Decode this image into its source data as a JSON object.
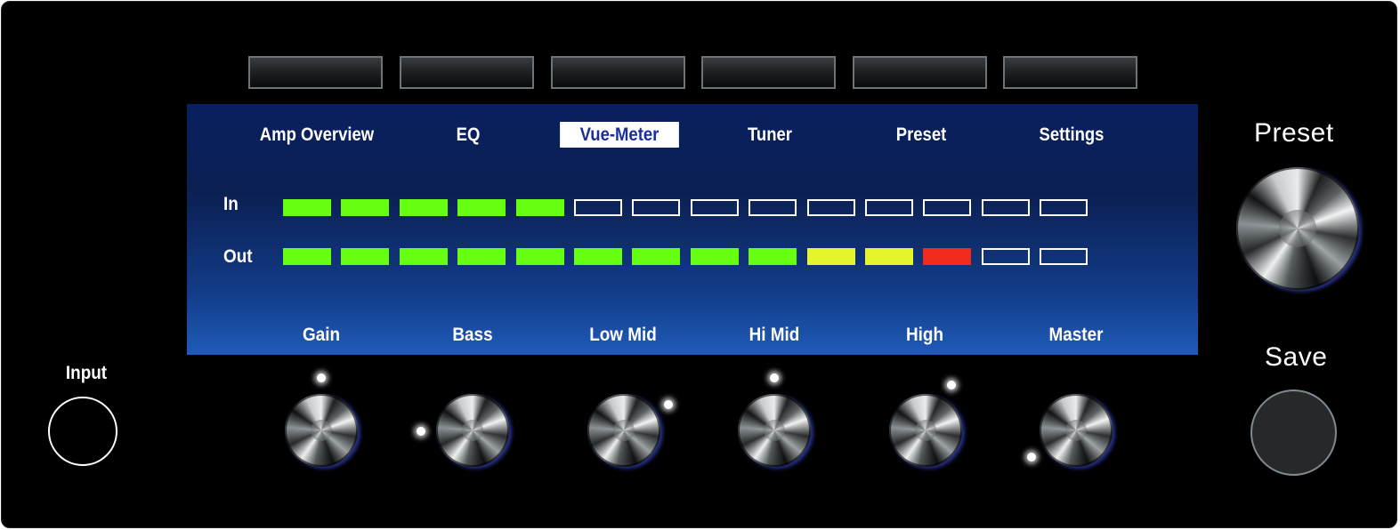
{
  "tabs": [
    {
      "label": "Amp Overview"
    },
    {
      "label": "EQ"
    },
    {
      "label": "Vue-Meter",
      "active": true
    },
    {
      "label": "Tuner"
    },
    {
      "label": "Preset"
    },
    {
      "label": "Settings"
    }
  ],
  "meter": {
    "in": {
      "label": "In",
      "segments": [
        "green",
        "green",
        "green",
        "green",
        "green",
        "off",
        "off",
        "off",
        "off",
        "off",
        "off",
        "off",
        "off",
        "off"
      ]
    },
    "out": {
      "label": "Out",
      "segments": [
        "green",
        "green",
        "green",
        "green",
        "green",
        "green",
        "green",
        "green",
        "green",
        "yellow",
        "yellow",
        "red",
        "off",
        "off"
      ]
    }
  },
  "knobs": [
    {
      "label": "Gain"
    },
    {
      "label": "Bass"
    },
    {
      "label": "Low Mid"
    },
    {
      "label": "Hi Mid"
    },
    {
      "label": "High"
    },
    {
      "label": "Master"
    }
  ],
  "input": {
    "label": "Input"
  },
  "preset": {
    "label": "Preset"
  },
  "save": {
    "label": "Save"
  },
  "colors": {
    "segment_green": "#66ff12",
    "segment_yellow": "#e5f52c",
    "segment_red": "#f22b1c",
    "active_tab_text": "#1a2f9c"
  }
}
